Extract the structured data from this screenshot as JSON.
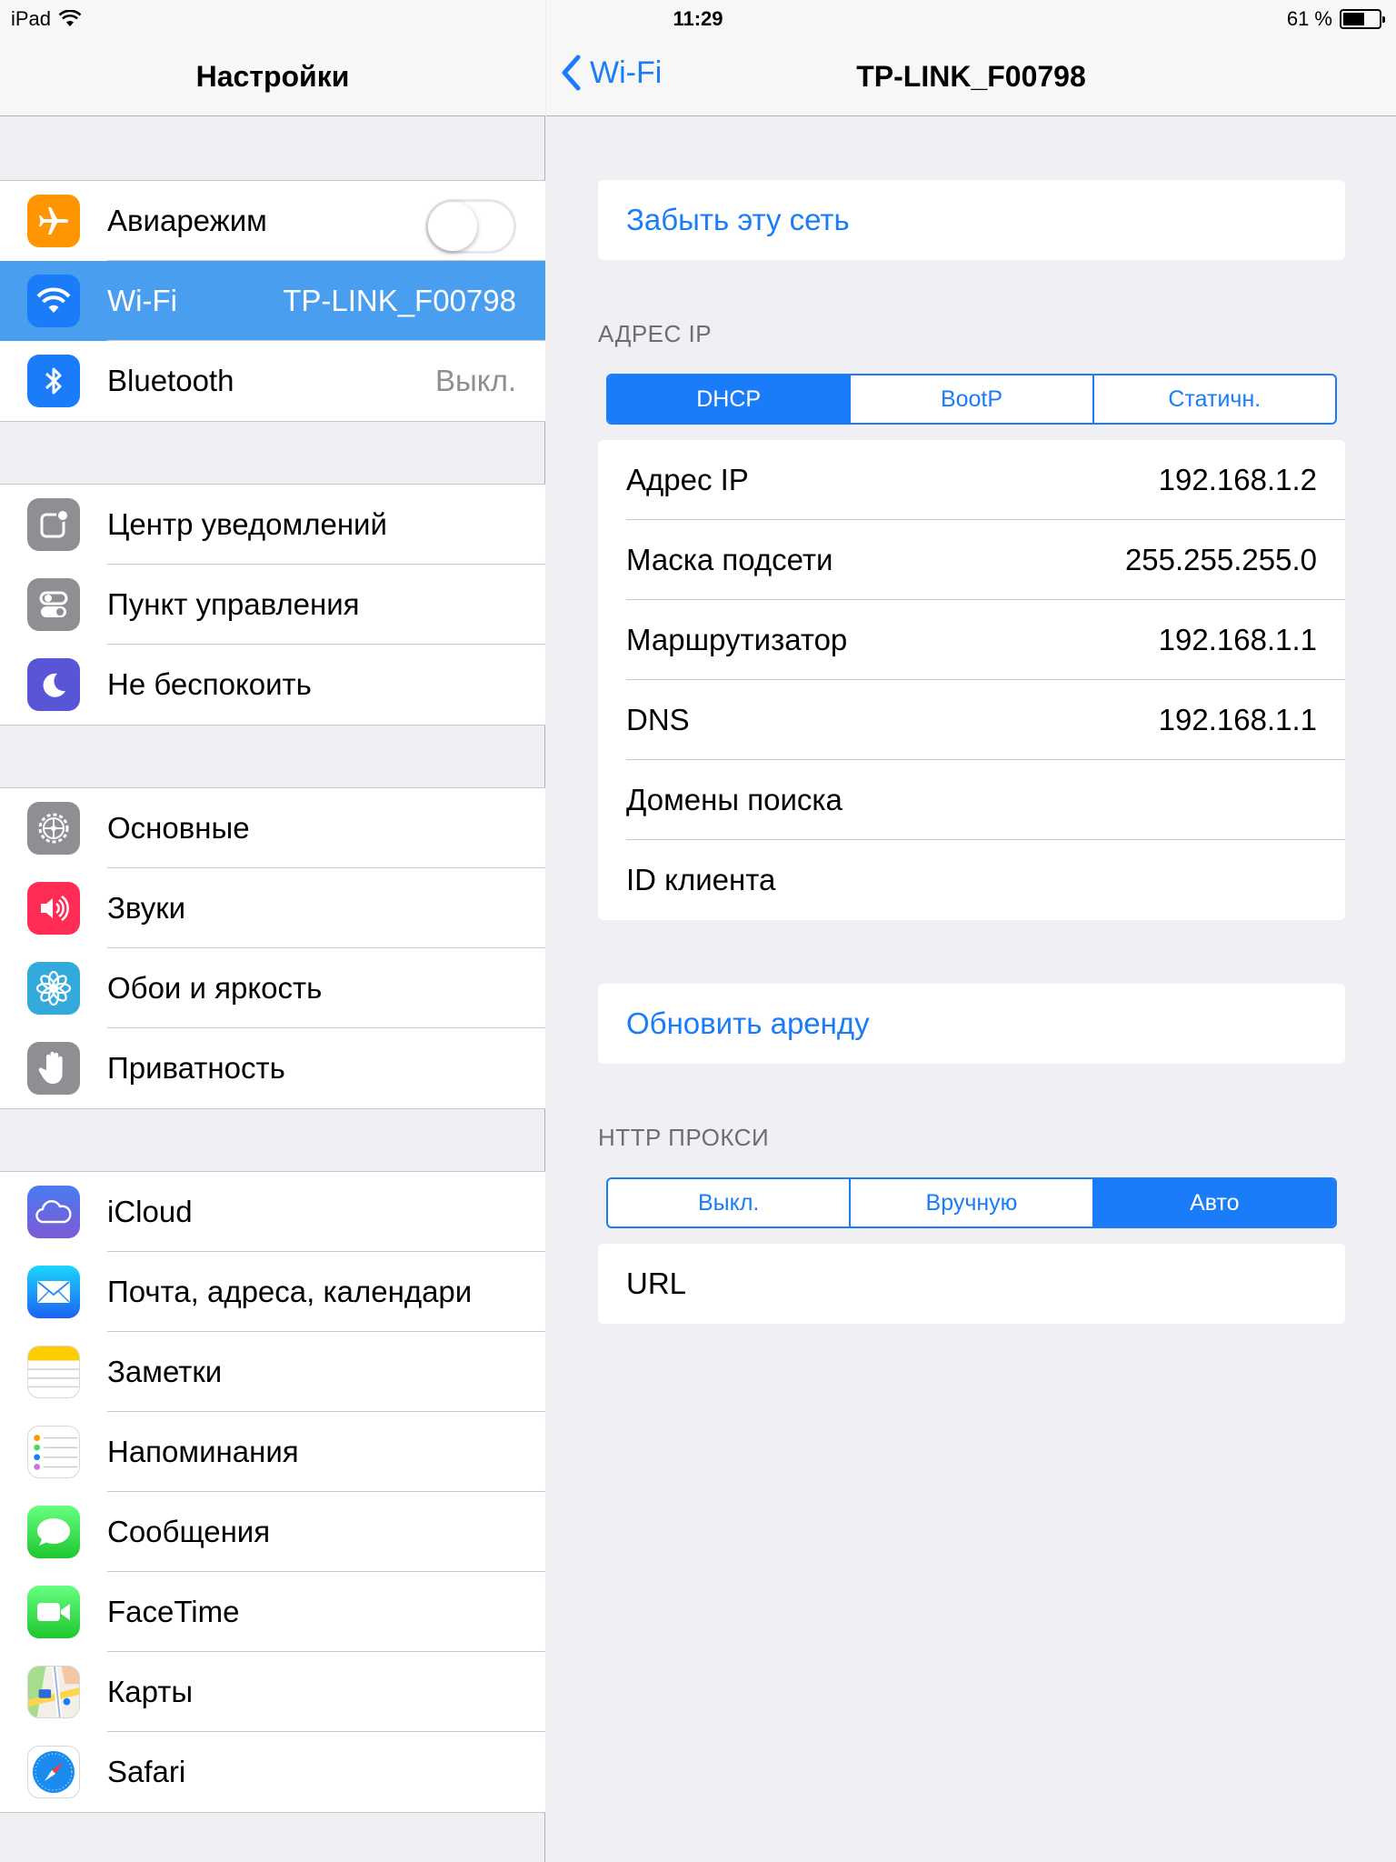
{
  "status_bar": {
    "device": "iPad",
    "time": "11:29",
    "battery_text": "61 %",
    "battery_level": 0.61
  },
  "master": {
    "title": "Настройки",
    "groups": [
      [
        {
          "label": "Авиарежим",
          "icon": "airplane-icon",
          "toggle": false
        },
        {
          "label": "Wi-Fi",
          "icon": "wifi-icon",
          "value": "TP-LINK_F00798",
          "selected": true
        },
        {
          "label": "Bluetooth",
          "icon": "bluetooth-icon",
          "value": "Выкл."
        }
      ],
      [
        {
          "label": "Центр уведомлений",
          "icon": "notification-center-icon"
        },
        {
          "label": "Пункт управления",
          "icon": "control-center-icon"
        },
        {
          "label": "Не беспокоить",
          "icon": "moon-icon"
        }
      ],
      [
        {
          "label": "Основные",
          "icon": "gear-icon"
        },
        {
          "label": "Звуки",
          "icon": "speaker-icon"
        },
        {
          "label": "Обои и яркость",
          "icon": "flower-icon"
        },
        {
          "label": "Приватность",
          "icon": "hand-icon"
        }
      ],
      [
        {
          "label": "iCloud",
          "icon": "cloud-icon"
        },
        {
          "label": "Почта, адреса, календари",
          "icon": "mail-icon"
        },
        {
          "label": "Заметки",
          "icon": "notes-icon"
        },
        {
          "label": "Напоминания",
          "icon": "reminders-icon"
        },
        {
          "label": "Сообщения",
          "icon": "messages-icon"
        },
        {
          "label": "FaceTime",
          "icon": "facetime-icon"
        },
        {
          "label": "Карты",
          "icon": "maps-icon"
        },
        {
          "label": "Safari",
          "icon": "compass-icon"
        }
      ]
    ]
  },
  "detail": {
    "back_label": "Wi-Fi",
    "title": "TP-LINK_F00798",
    "forget_label": "Забыть эту сеть",
    "ip_header": "АДРЕС IP",
    "ip_modes": [
      "DHCP",
      "BootP",
      "Статичн."
    ],
    "ip_mode_selected": 0,
    "ip_rows": [
      {
        "label": "Адрес IP",
        "value": "192.168.1.2"
      },
      {
        "label": "Маска подсети",
        "value": "255.255.255.0"
      },
      {
        "label": "Маршрутизатор",
        "value": "192.168.1.1"
      },
      {
        "label": "DNS",
        "value": "192.168.1.1"
      },
      {
        "label": "Домены поиска",
        "value": ""
      },
      {
        "label": "ID клиента",
        "value": ""
      }
    ],
    "renew_label": "Обновить аренду",
    "proxy_header": "HTTP ПРОКСИ",
    "proxy_modes": [
      "Выкл.",
      "Вручную",
      "Авто"
    ],
    "proxy_mode_selected": 2,
    "proxy_rows": [
      {
        "label": "URL",
        "value": ""
      }
    ]
  },
  "colors": {
    "accent": "#1a7cf9",
    "selected_row": "#4a9ef0",
    "background": "#efeff4",
    "secondary_text": "#8e8e93"
  }
}
